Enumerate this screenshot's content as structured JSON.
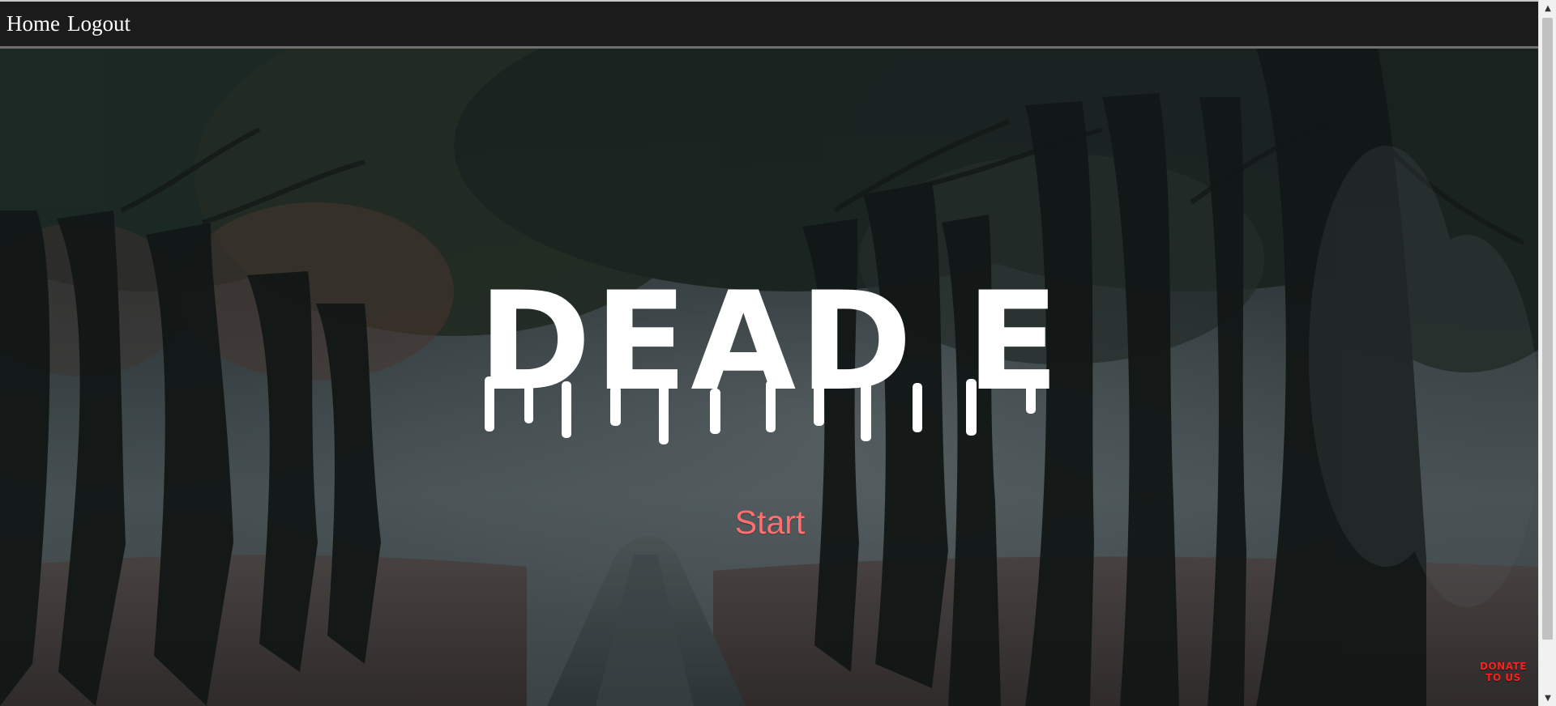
{
  "nav": {
    "links": [
      {
        "label": "Home"
      },
      {
        "label": "Logout"
      }
    ]
  },
  "hero": {
    "title": "DEAD END",
    "start_label": "Start"
  },
  "donate": {
    "line1": "DONATE",
    "line2": "TO US"
  },
  "colors": {
    "navbar": "#1b1b1b",
    "start_text": "#ff6f6f",
    "donate_text": "#ff1f1f",
    "title_text": "#ffffff"
  },
  "scrollbar": {
    "up_icon": "chevron-up-icon",
    "down_icon": "chevron-down-icon"
  }
}
